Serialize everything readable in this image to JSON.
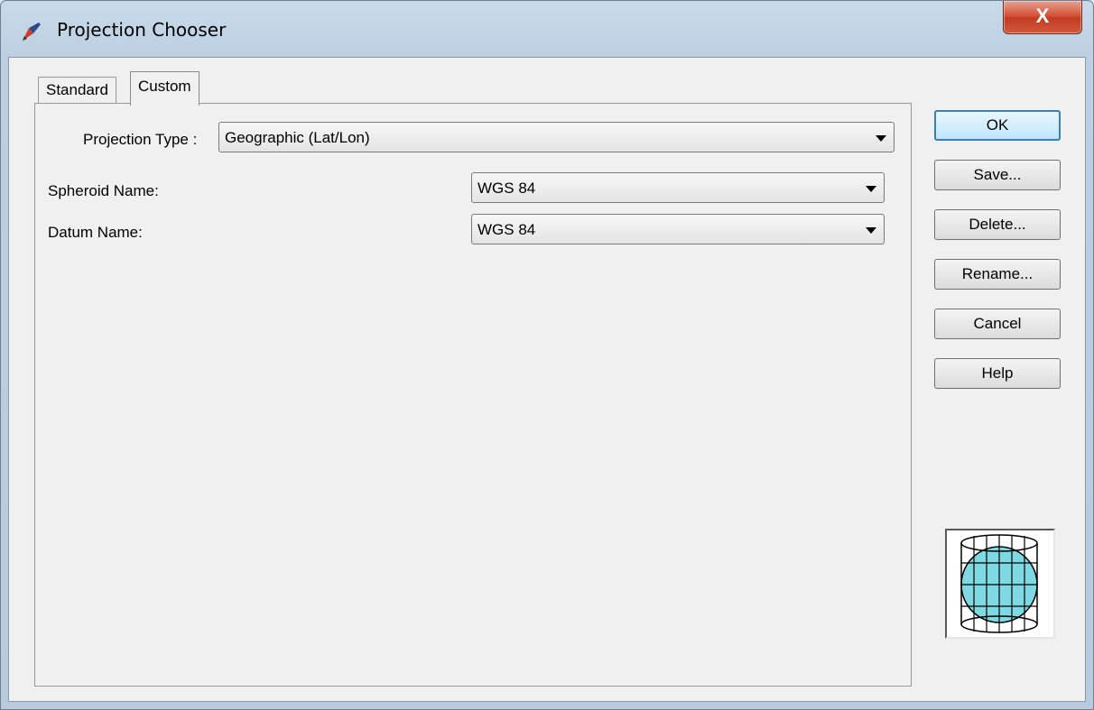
{
  "window": {
    "title": "Projection Chooser",
    "close_glyph": "X"
  },
  "tabs": [
    {
      "label": "Standard",
      "selected": false
    },
    {
      "label": "Custom",
      "selected": true
    }
  ],
  "form": {
    "projection_type_label": "Projection Type :",
    "projection_type_value": "Geographic (Lat/Lon)",
    "spheroid_label": "Spheroid Name:",
    "spheroid_value": "WGS 84",
    "datum_label": "Datum Name:",
    "datum_value": "WGS 84"
  },
  "buttons": {
    "ok": "OK",
    "save": "Save...",
    "delete": "Delete...",
    "rename": "Rename...",
    "cancel": "Cancel",
    "help": "Help"
  },
  "icons": {
    "app": "projection-pencil-icon",
    "preview": "cylinder-projection-globe-icon",
    "globe_fill": "#7fd9e3"
  }
}
